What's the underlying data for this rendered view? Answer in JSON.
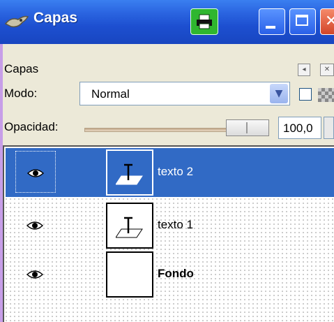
{
  "window": {
    "title": "Capas",
    "icon": "gimp-wilber-icon"
  },
  "titlebar_buttons": [
    "print-icon",
    "minimize-icon",
    "maximize-icon",
    "close-icon"
  ],
  "panel": {
    "header_label": "Capas",
    "mode_label": "Modo:",
    "mode_value": "Normal",
    "opacity_label": "Opacidad:",
    "opacity_value": "100,0"
  },
  "layers": [
    {
      "name": "texto 2",
      "visible_icon": "eye-icon",
      "thumb_icon": "text-layer-icon",
      "selected": true,
      "bold": false
    },
    {
      "name": "texto 1",
      "visible_icon": "eye-icon",
      "thumb_icon": "text-layer-icon",
      "selected": false,
      "bold": false
    },
    {
      "name": "Fondo",
      "visible_icon": "eye-icon",
      "thumb_icon": "",
      "selected": false,
      "bold": true
    }
  ],
  "colors": {
    "titlebar": "#2a64e0",
    "selection": "#316ac5",
    "panel_bg": "#ece9d8"
  }
}
